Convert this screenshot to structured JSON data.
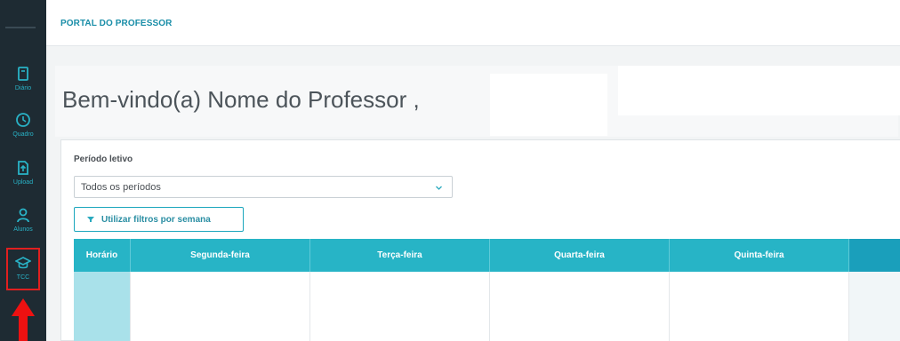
{
  "sidebar": {
    "items": [
      {
        "label": "Diário",
        "icon": "notebook-icon"
      },
      {
        "label": "Quadro",
        "icon": "clock-icon"
      },
      {
        "label": "Upload",
        "icon": "upload-icon"
      },
      {
        "label": "Alunos",
        "icon": "user-icon"
      },
      {
        "label": "TCC",
        "icon": "graduation-cap-icon"
      }
    ],
    "highlight_color": "#e01f1f",
    "accent_color": "#29b3c7"
  },
  "header": {
    "title": "PORTAL DO PROFESSOR"
  },
  "welcome": {
    "text": "Bem-vindo(a) Nome do Professor ,"
  },
  "filters": {
    "periodo_label": "Período letivo",
    "periodo_value": "Todos os períodos",
    "week_filter_label": "Utilizar filtros por semana"
  },
  "schedule": {
    "columns": [
      "Horário",
      "Segunda-feira",
      "Terça-feira",
      "Quarta-feira",
      "Quinta-feira",
      ""
    ]
  }
}
